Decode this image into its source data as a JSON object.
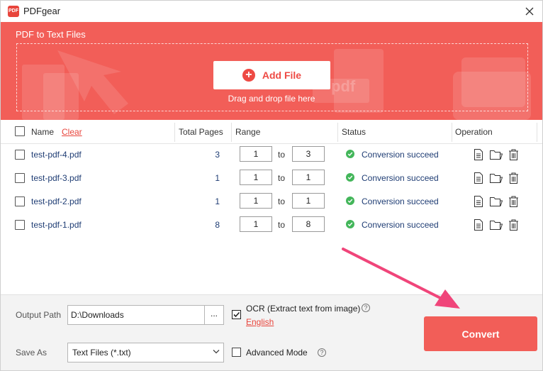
{
  "window": {
    "app_title": "PDFgear",
    "logo_text": "PDF",
    "close_icon": "close-icon"
  },
  "hero": {
    "title": "PDF to Text Files",
    "add_file_label": "Add File",
    "drag_text": "Drag and drop file here",
    "decor_text": "pdf",
    "background_color": "#f25e58",
    "accent_color": "#ee4a44"
  },
  "table": {
    "headers": {
      "name": "Name",
      "clear": "Clear",
      "total_pages": "Total Pages",
      "range": "Range",
      "status": "Status",
      "operation": "Operation"
    },
    "range_separator": "to",
    "rows": [
      {
        "name": "test-pdf-4.pdf",
        "total_pages": "3",
        "range_from": "1",
        "range_to": "3",
        "status": "Conversion succeed"
      },
      {
        "name": "test-pdf-3.pdf",
        "total_pages": "1",
        "range_from": "1",
        "range_to": "1",
        "status": "Conversion succeed"
      },
      {
        "name": "test-pdf-2.pdf",
        "total_pages": "1",
        "range_from": "1",
        "range_to": "1",
        "status": "Conversion succeed"
      },
      {
        "name": "test-pdf-1.pdf",
        "total_pages": "8",
        "range_from": "1",
        "range_to": "8",
        "status": "Conversion succeed"
      }
    ],
    "status_color": "#43b65a"
  },
  "bottom": {
    "output_path_label": "Output Path",
    "output_path_value": "D:\\Downloads",
    "browse_label": "...",
    "ocr_label": "OCR (Extract text from image)",
    "ocr_checked": true,
    "ocr_language": "English",
    "save_as_label": "Save As",
    "save_as_value": "Text Files (*.txt)",
    "advanced_mode_label": "Advanced Mode",
    "advanced_mode_checked": false,
    "help_glyph": "?",
    "convert_label": "Convert"
  },
  "annotation": {
    "arrow_color": "#f0457a"
  }
}
